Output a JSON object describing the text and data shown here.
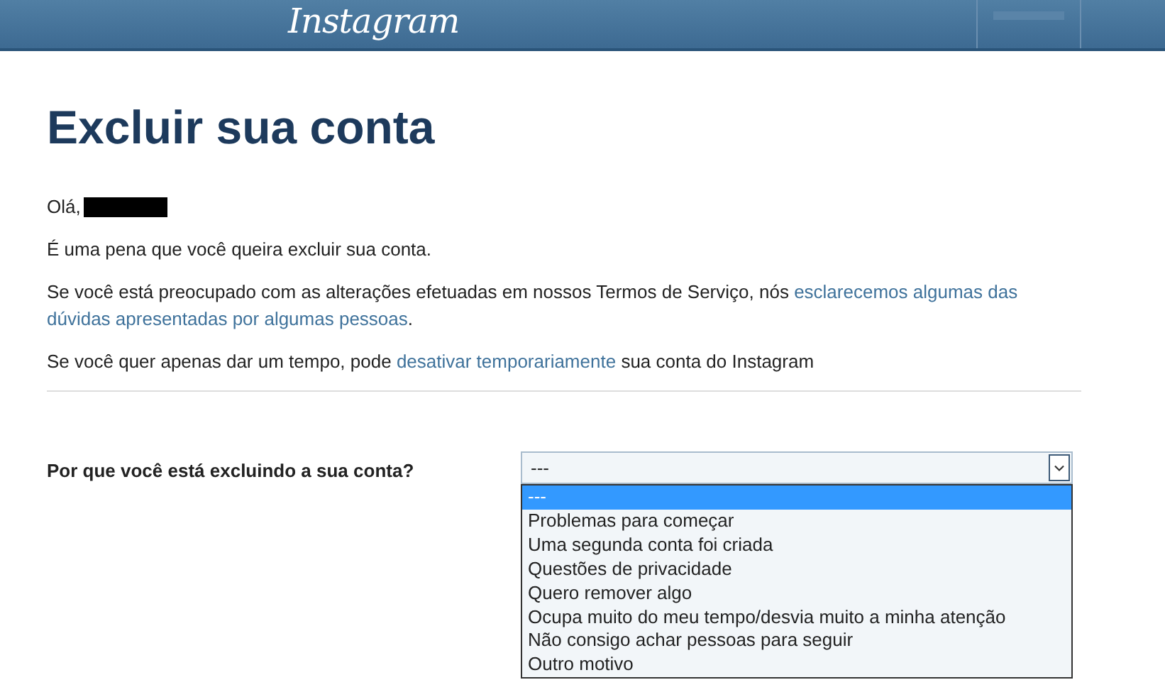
{
  "header": {
    "logo": "Instagram"
  },
  "title": "Excluir sua conta",
  "greeting": {
    "text": "Olá,",
    "name_redacted": true
  },
  "paragraphs": [
    [
      {
        "kind": "text",
        "text": "É uma pena que você queira excluir sua conta."
      }
    ],
    [
      {
        "kind": "text",
        "text": "Se você está preocupado com as alterações efetuadas em nossos Termos de Serviço, nós "
      },
      {
        "kind": "link",
        "text": "esclarecemos algumas das"
      },
      {
        "kind": "space"
      },
      {
        "kind": "link",
        "text": "dúvidas apresentadas por algumas pessoas"
      },
      {
        "kind": "text",
        "text": "."
      }
    ],
    [
      {
        "kind": "text",
        "text": "Se você quer apenas dar um tempo, pode "
      },
      {
        "kind": "link",
        "text": "desativar temporariamente"
      },
      {
        "kind": "text",
        "text": " sua conta do Instagram"
      }
    ]
  ],
  "reason": {
    "label": "Por que você está excluindo a sua conta?",
    "value": "---",
    "expanded": true,
    "options": [
      {
        "label": "---",
        "selected": true
      },
      {
        "label": "Problemas para começar",
        "selected": false
      },
      {
        "label": "Uma segunda conta foi criada",
        "selected": false
      },
      {
        "label": "Questões de privacidade",
        "selected": false
      },
      {
        "label": "Quero remover algo",
        "selected": false
      },
      {
        "label": "Ocupa muito do meu tempo/desvia muito a minha atenção",
        "selected": false
      },
      {
        "label": "Não consigo achar pessoas para seguir",
        "selected": false
      },
      {
        "label": "Outro motivo",
        "selected": false
      }
    ]
  }
}
